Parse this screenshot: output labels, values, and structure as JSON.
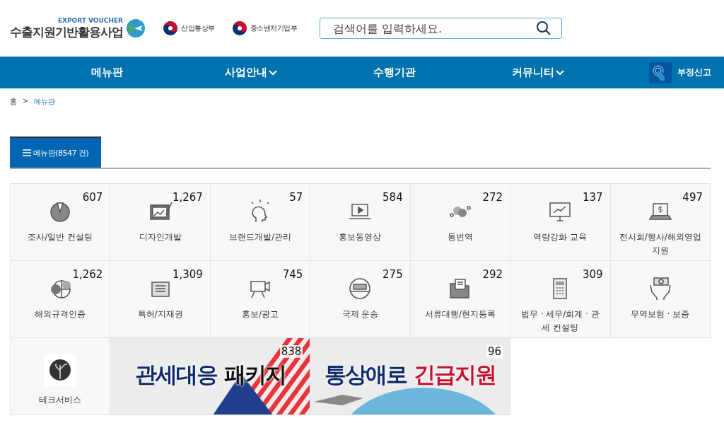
{
  "header": {
    "logo_caption": "EXPORT VOUCHER",
    "logo_title": "수출지원기반활용사업",
    "ministries": [
      "산업통상부",
      "중소벤처기업부"
    ],
    "search": {
      "placeholder": "검색어를 입력하세요."
    }
  },
  "nav": {
    "items": [
      {
        "label": "메뉴판",
        "has_dropdown": false
      },
      {
        "label": "사업안내",
        "has_dropdown": true
      },
      {
        "label": "수행기관",
        "has_dropdown": false
      },
      {
        "label": "커뮤니티",
        "has_dropdown": true
      }
    ],
    "report": "부정신고"
  },
  "breadcrumb": [
    "홈",
    ">",
    "메뉴판"
  ],
  "tabs": [
    {
      "label": "메뉴판(8547 건)",
      "selected": true
    }
  ],
  "categories": [
    {
      "label": "조사/일반 컨설팅",
      "count": "607"
    },
    {
      "label": "디자인개발",
      "count": "1,267"
    },
    {
      "label": "브랜드개발/관리",
      "count": "57"
    },
    {
      "label": "홍보동영상",
      "count": "584"
    },
    {
      "label": "통번역",
      "count": "272"
    },
    {
      "label": "역량강화 교육",
      "count": "137"
    },
    {
      "label": "전시회/행사/해외영업지원",
      "count": "497"
    },
    {
      "label": "해외규격인증",
      "count": "1,262"
    },
    {
      "label": "특허/지재권",
      "count": "1,309"
    },
    {
      "label": "홍보/광고",
      "count": "745"
    },
    {
      "label": "국제 운송",
      "count": "275"
    },
    {
      "label": "서류대행/현지등록",
      "count": "292"
    },
    {
      "label": "법무 · 세무/회계 · 관세 컨설팅",
      "count": "309"
    },
    {
      "label": "무역보험 · 보증"
    },
    {
      "label": "테크서비스"
    }
  ],
  "banners": [
    {
      "kind": "flag",
      "count": "838",
      "title": [
        {
          "text": "관세대응",
          "color": "#0d2a6b"
        },
        {
          "text": "패키지",
          "color": "#111111"
        }
      ]
    },
    {
      "kind": "globe",
      "count": "96",
      "title": [
        {
          "text": "통상애로",
          "color": "#0d2a6b"
        },
        {
          "text": "긴급지원",
          "color": "#c8102e"
        }
      ]
    }
  ]
}
